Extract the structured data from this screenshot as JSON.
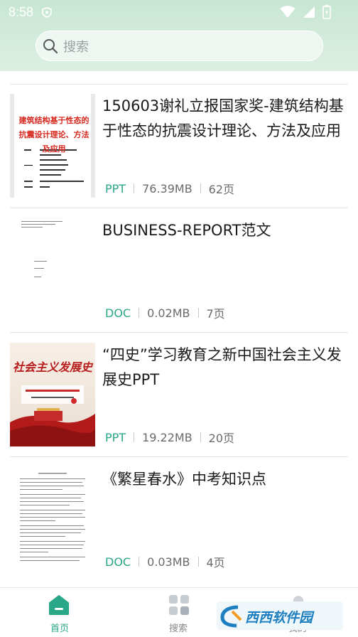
{
  "status_bar": {
    "time": "8:58"
  },
  "search": {
    "placeholder": "搜索"
  },
  "items": [
    {
      "title": "150603谢礼立报国家奖-建筑结构基于性态的抗震设计理论、方法及应用",
      "type": "PPT",
      "size": "76.39MB",
      "pages": "62页"
    },
    {
      "title": "BUSINESS-REPORT范文",
      "type": "DOC",
      "size": "0.02MB",
      "pages": "7页"
    },
    {
      "title": "“四史”学习教育之新中国社会主义发展史PPT",
      "type": "PPT",
      "size": "19.22MB",
      "pages": "20页"
    },
    {
      "title": "《繁星春水》中考知识点",
      "type": "DOC",
      "size": "0.03MB",
      "pages": "4页"
    }
  ],
  "nav": [
    {
      "label": "首页",
      "icon": "home-icon",
      "active": true
    },
    {
      "label": "搜索",
      "icon": "grid-icon",
      "active": false
    },
    {
      "label": "我的",
      "icon": "user-icon",
      "active": false
    }
  ],
  "colors": {
    "accent": "#2aa786",
    "header": "#c8e6d4",
    "meta": "#6a6a6a"
  },
  "thumb_text": {
    "item0_heading": "建筑结构基于性态的抗震设计理论、方法及应用",
    "item2_heading": "社会主义发展史"
  },
  "watermark": {
    "text": "西西软件园"
  }
}
